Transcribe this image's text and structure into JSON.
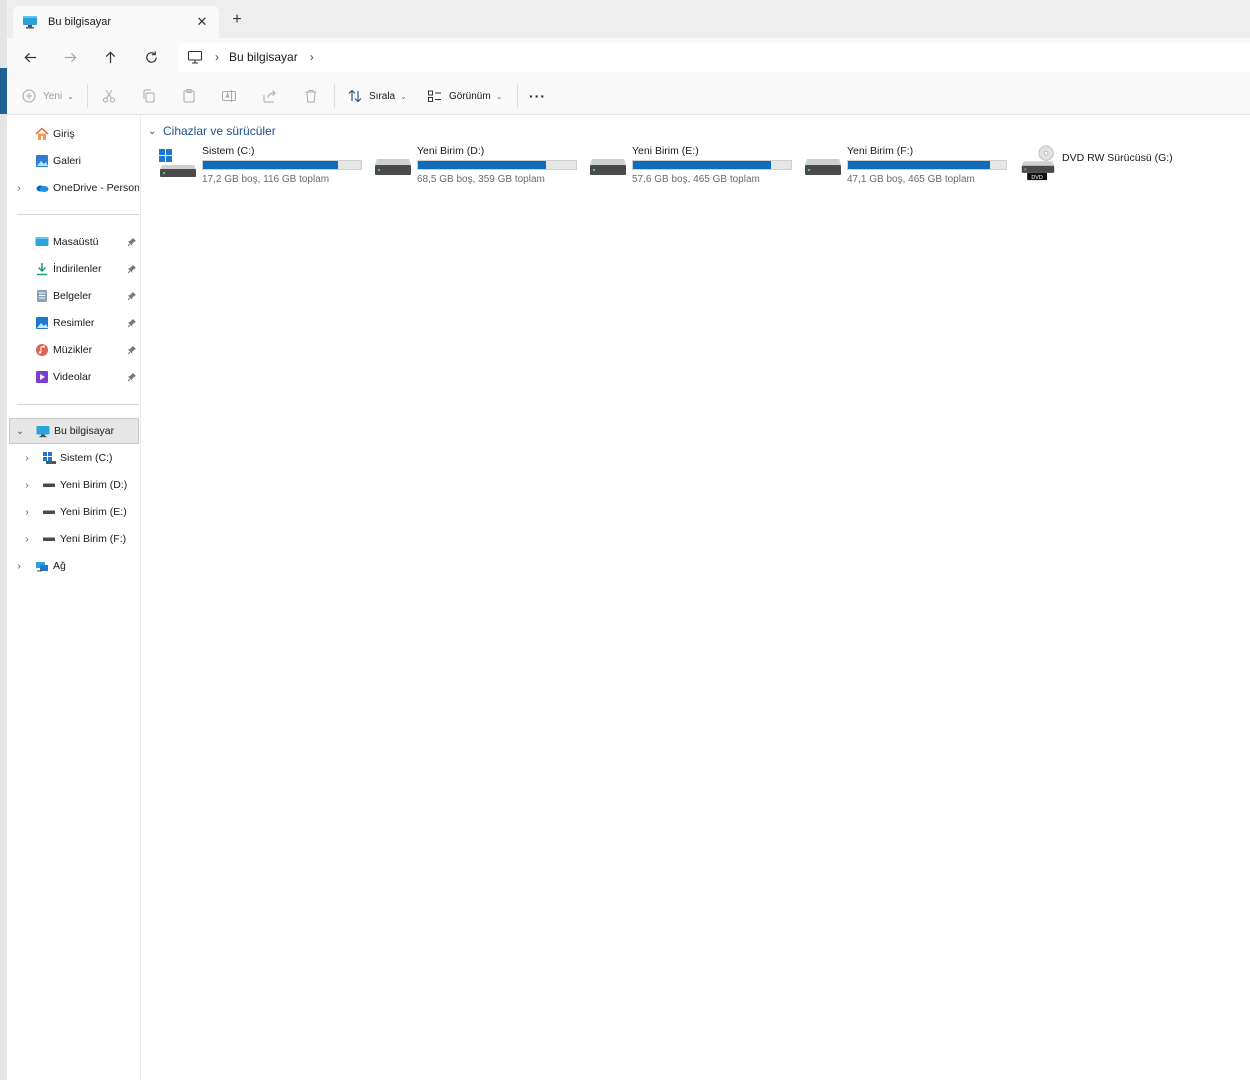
{
  "tab": {
    "title": "Bu bilgisayar",
    "close": "✕",
    "new_tab": "+"
  },
  "address": {
    "separator": "›",
    "crumb": "Bu bilgisayar"
  },
  "toolbar": {
    "new_label": "Yeni",
    "sort_label": "Sırala",
    "view_label": "Görünüm",
    "more_label": "···"
  },
  "sidebar": {
    "quick": [
      {
        "label": "Giriş",
        "icon": "home-icon"
      },
      {
        "label": "Galeri",
        "icon": "gallery-icon"
      },
      {
        "label": "OneDrive - Persona",
        "icon": "onedrive-icon"
      }
    ],
    "pinned": [
      {
        "label": "Masaüstü",
        "icon": "desktop-icon"
      },
      {
        "label": "İndirilenler",
        "icon": "downloads-icon"
      },
      {
        "label": "Belgeler",
        "icon": "documents-icon"
      },
      {
        "label": "Resimler",
        "icon": "pictures-icon"
      },
      {
        "label": "Müzikler",
        "icon": "music-icon"
      },
      {
        "label": "Videolar",
        "icon": "videos-icon"
      }
    ],
    "this_pc": "Bu bilgisayar",
    "drives": [
      {
        "label": "Sistem (C:)"
      },
      {
        "label": "Yeni Birim (D:)"
      },
      {
        "label": "Yeni Birim (E:)"
      },
      {
        "label": "Yeni Birim (F:)"
      }
    ],
    "network": "Ağ"
  },
  "content": {
    "group_title": "Cihazlar ve sürücüler",
    "drives": [
      {
        "name": "Sistem (C:)",
        "info": "17,2 GB boş, 116 GB toplam",
        "used_fraction": 0.852
      },
      {
        "name": "Yeni Birim (D:)",
        "info": "68,5 GB boş, 359 GB toplam",
        "used_fraction": 0.809
      },
      {
        "name": "Yeni Birim (E:)",
        "info": "57,6 GB boş, 465 GB toplam",
        "used_fraction": 0.876
      },
      {
        "name": "Yeni Birim (F:)",
        "info": "47,1 GB boş, 465 GB toplam",
        "used_fraction": 0.899
      }
    ],
    "dvd": {
      "name": "DVD RW Sürücüsü (G:)",
      "badge": "DVD"
    }
  },
  "colors": {
    "accent": "#0f6cbd",
    "group_header": "#1f4e8a"
  }
}
